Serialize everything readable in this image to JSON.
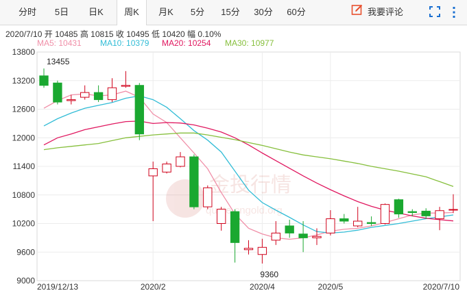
{
  "tabs": [
    {
      "label": "分时"
    },
    {
      "label": "5日"
    },
    {
      "label": "日K"
    },
    {
      "label": "周K",
      "active": true
    },
    {
      "label": "月K"
    },
    {
      "label": "5分"
    },
    {
      "label": "15分"
    },
    {
      "label": "30分"
    },
    {
      "label": "60分"
    }
  ],
  "toolbar": {
    "comment_label": "我要评论",
    "accent_color": "#e8502e",
    "icons": [
      "edit-icon",
      "fullscreen-icon",
      "more-vertical-icon"
    ]
  },
  "info": {
    "date": "2020/7/10",
    "open_label": "开",
    "open": "10485",
    "high_label": "高",
    "high": "10815",
    "close_label": "收",
    "close": "10495",
    "low_label": "低",
    "low": "10420",
    "amp_label": "幅",
    "amp": "0.10%"
  },
  "ma": [
    {
      "label": "MA5: 10431",
      "color": "#f08fa8"
    },
    {
      "label": "MA10: 10379",
      "color": "#31bcd6"
    },
    {
      "label": "MA20: 10254",
      "color": "#e0175f"
    },
    {
      "label": "MA30: 10977",
      "color": "#86bf3c"
    }
  ],
  "watermark": {
    "text_cn": "金投行情",
    "text_url": "quote.cngold.org"
  },
  "chart_data": {
    "type": "candlestick",
    "ylim": [
      9000,
      13800
    ],
    "y_ticks": [
      "13800",
      "13200",
      "12600",
      "12000",
      "11400",
      "10800",
      "10200",
      "9600",
      "9000"
    ],
    "x_labels": [
      {
        "label": "2019/12/13",
        "index": 0
      },
      {
        "label": "2020/2",
        "index": 8
      },
      {
        "label": "2020/4",
        "index": 16
      },
      {
        "label": "2020/5",
        "index": 21
      },
      {
        "label": "2020/7/10",
        "index": 30
      }
    ],
    "up_color": "#d0021b",
    "down_color": "#1aa830",
    "annotations": [
      {
        "label": "13455",
        "index": 0,
        "value": 13455
      },
      {
        "label": "9360",
        "index": 16,
        "value": 9360
      }
    ],
    "candles": [
      {
        "o": 13300,
        "c": 13100,
        "h": 13455,
        "l": 13050
      },
      {
        "o": 13150,
        "c": 12750,
        "h": 13200,
        "l": 12700
      },
      {
        "o": 12780,
        "c": 12800,
        "h": 12900,
        "l": 12700
      },
      {
        "o": 12850,
        "c": 12950,
        "h": 13100,
        "l": 12800
      },
      {
        "o": 12950,
        "c": 12800,
        "h": 13100,
        "l": 12750
      },
      {
        "o": 12800,
        "c": 13050,
        "h": 13250,
        "l": 12750
      },
      {
        "o": 13080,
        "c": 13100,
        "h": 13400,
        "l": 13050
      },
      {
        "o": 13100,
        "c": 12080,
        "h": 13150,
        "l": 11950
      },
      {
        "o": 11200,
        "c": 11350,
        "h": 11500,
        "l": 10250
      },
      {
        "o": 11280,
        "c": 11450,
        "h": 11500,
        "l": 11250
      },
      {
        "o": 11400,
        "c": 11600,
        "h": 11700,
        "l": 11380
      },
      {
        "o": 11600,
        "c": 10550,
        "h": 11650,
        "l": 10500
      },
      {
        "o": 10550,
        "c": 10950,
        "h": 11000,
        "l": 10500
      },
      {
        "o": 10200,
        "c": 10500,
        "h": 10550,
        "l": 10050
      },
      {
        "o": 10450,
        "c": 9800,
        "h": 10500,
        "l": 9380
      },
      {
        "o": 9650,
        "c": 9680,
        "h": 9850,
        "l": 9550
      },
      {
        "o": 9550,
        "c": 9700,
        "h": 9880,
        "l": 9360
      },
      {
        "o": 9850,
        "c": 10000,
        "h": 10250,
        "l": 9750
      },
      {
        "o": 10150,
        "c": 10000,
        "h": 10280,
        "l": 9900
      },
      {
        "o": 9980,
        "c": 9900,
        "h": 10250,
        "l": 9600
      },
      {
        "o": 9900,
        "c": 9930,
        "h": 10100,
        "l": 9750
      },
      {
        "o": 10000,
        "c": 10300,
        "h": 10480,
        "l": 9950
      },
      {
        "o": 10300,
        "c": 10250,
        "h": 10400,
        "l": 10200
      },
      {
        "o": 10150,
        "c": 10250,
        "h": 10550,
        "l": 10120
      },
      {
        "o": 10220,
        "c": 10200,
        "h": 10350,
        "l": 10150
      },
      {
        "o": 10200,
        "c": 10600,
        "h": 10620,
        "l": 10180
      },
      {
        "o": 10700,
        "c": 10400,
        "h": 10720,
        "l": 10320
      },
      {
        "o": 10450,
        "c": 10430,
        "h": 10500,
        "l": 10350
      },
      {
        "o": 10460,
        "c": 10360,
        "h": 10520,
        "l": 10300
      },
      {
        "o": 10300,
        "c": 10470,
        "h": 10550,
        "l": 10060
      },
      {
        "o": 10485,
        "c": 10495,
        "h": 10815,
        "l": 10420
      }
    ],
    "series": [
      {
        "name": "MA5",
        "color": "#f08fa8",
        "values": [
          12620,
          12780,
          12900,
          12920,
          12880,
          12900,
          12980,
          12850,
          12500,
          12320,
          12000,
          11680,
          11350,
          10850,
          10400,
          10100,
          9980,
          9900,
          9870,
          9900,
          9960,
          10040,
          10080,
          10100,
          10150,
          10220,
          10300,
          10380,
          10420,
          10420,
          10431
        ]
      },
      {
        "name": "MA10",
        "color": "#31bcd6",
        "values": [
          12250,
          12400,
          12520,
          12620,
          12680,
          12740,
          12830,
          12880,
          12800,
          12640,
          12400,
          12150,
          11950,
          11700,
          11300,
          10900,
          10640,
          10480,
          10330,
          10170,
          10030,
          10000,
          10020,
          10060,
          10120,
          10160,
          10200,
          10250,
          10300,
          10340,
          10379
        ]
      },
      {
        "name": "MA20",
        "color": "#e0175f",
        "values": [
          11850,
          12000,
          12080,
          12170,
          12230,
          12290,
          12340,
          12350,
          12300,
          12320,
          12310,
          12270,
          12200,
          12120,
          12000,
          11850,
          11680,
          11520,
          11360,
          11200,
          11050,
          10910,
          10780,
          10660,
          10560,
          10480,
          10420,
          10360,
          10310,
          10280,
          10254
        ]
      },
      {
        "name": "MA30",
        "color": "#86bf3c",
        "values": [
          11750,
          11790,
          11820,
          11850,
          11880,
          11940,
          12000,
          12030,
          12060,
          12080,
          12100,
          12100,
          12060,
          12010,
          11960,
          11900,
          11840,
          11770,
          11700,
          11640,
          11600,
          11560,
          11510,
          11460,
          11400,
          11350,
          11300,
          11240,
          11180,
          11080,
          10977
        ]
      }
    ]
  }
}
